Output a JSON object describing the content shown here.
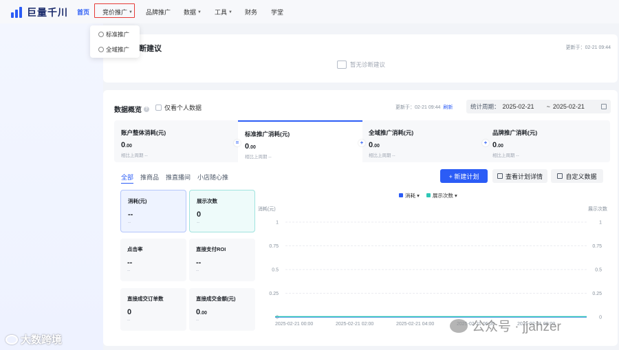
{
  "brand": {
    "name": "巨量千川"
  },
  "nav": {
    "items": [
      {
        "label": "首页"
      },
      {
        "label": "竞价推广"
      },
      {
        "label": "品牌推广"
      },
      {
        "label": "数据"
      },
      {
        "label": "工具"
      },
      {
        "label": "财务"
      },
      {
        "label": "学堂"
      }
    ],
    "dropdown": [
      {
        "label": "标准推广"
      },
      {
        "label": "全域推广"
      }
    ]
  },
  "diagnosis": {
    "title_suffix": "断建议",
    "update": "更新于：02-21 09:44",
    "empty": "暂无诊断建议"
  },
  "overview": {
    "title": "数据概览",
    "own_only": "仅看个人数据",
    "update": "更新于：02-21 09:44",
    "refresh": "刷新",
    "date_label": "统计周期：",
    "date_start": "2025-02-21",
    "date_sep": "~",
    "date_end": "2025-02-21",
    "tiles": [
      {
        "name": "账户整体消耗(元)",
        "val": "0",
        "dec": ".00",
        "sub": "相比上周期 --"
      },
      {
        "name": "标准推广消耗(元)",
        "val": "0",
        "dec": ".00",
        "sub": "相比上周期 --"
      },
      {
        "name": "全域推广消耗(元)",
        "val": "0",
        "dec": ".00",
        "sub": "相比上周期 --"
      },
      {
        "name": "品牌推广消耗(元)",
        "val": "0",
        "dec": ".00",
        "sub": "相比上周期 --"
      }
    ],
    "tile_signs": [
      "=",
      "+",
      "+"
    ],
    "subtabs": [
      "全部",
      "推商品",
      "推直播间",
      "小店随心推"
    ],
    "buttons": {
      "new_plan": "+ 新建计划",
      "plan_detail": "查看计划详情",
      "custom_data": "自定义数据"
    },
    "metrics": [
      {
        "name": "消耗(元)",
        "val": "--",
        "dec": "",
        "sub": "--"
      },
      {
        "name": "展示次数",
        "val": "0",
        "dec": "",
        "sub": "--"
      },
      {
        "name": "点击率",
        "val": "--",
        "dec": "",
        "sub": "--"
      },
      {
        "name": "直接支付ROI",
        "val": "--",
        "dec": "",
        "sub": "--"
      },
      {
        "name": "直接成交订单数",
        "val": "0",
        "dec": "",
        "sub": "--"
      },
      {
        "name": "直接成交金额(元)",
        "val": "0",
        "dec": ".00",
        "sub": "--"
      }
    ]
  },
  "chart_data": {
    "type": "line",
    "ylabel_left": "消耗(元)",
    "ylabel_right": "展示次数",
    "yticks": [
      "0",
      "0.25",
      "0.5",
      "0.75",
      "1"
    ],
    "x": [
      "2025-02-21 00:00",
      "2025-02-21 02:00",
      "2025-02-21 04:00",
      "2025-02-21 06:00",
      "2025-02-21 08:00"
    ],
    "ylim": [
      0,
      1
    ],
    "legend_position": "top-center",
    "series": [
      {
        "name": "消耗",
        "color": "#2b5cf6",
        "values": [
          0,
          0,
          0,
          0,
          0
        ]
      },
      {
        "name": "展示次数",
        "color": "#2ec7b6",
        "values": [
          0,
          0,
          0,
          0,
          0
        ]
      }
    ]
  },
  "watermarks": {
    "left": "大数跨境",
    "right": "公众号 · jjahzer"
  },
  "colors": {
    "accent": "#2b5cf6",
    "highlight": "#e53935"
  }
}
